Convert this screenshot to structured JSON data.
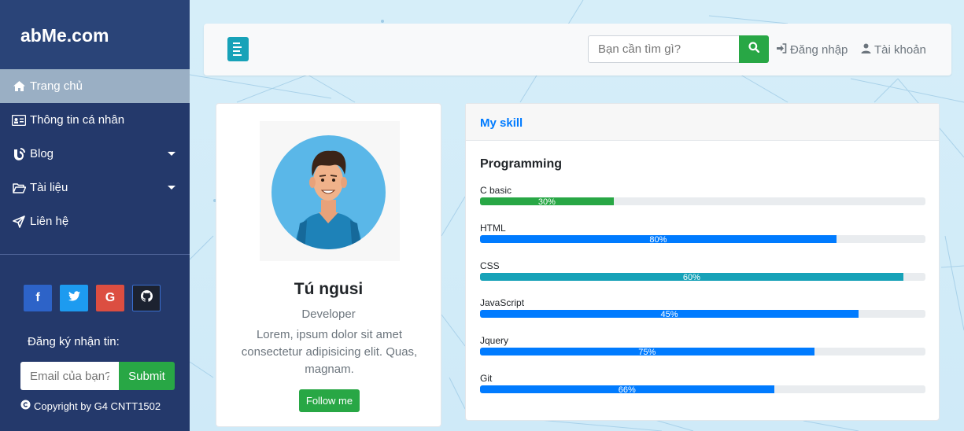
{
  "brand": "abMe.com",
  "sidebar": {
    "items": [
      {
        "label": "Trang chủ",
        "icon": "home-icon",
        "active": true
      },
      {
        "label": "Thông tin cá nhân",
        "icon": "id-card-icon"
      },
      {
        "label": "Blog",
        "icon": "blog-icon",
        "has_submenu": true
      },
      {
        "label": "Tài liệu",
        "icon": "folder-icon",
        "has_submenu": true
      },
      {
        "label": "Liên hệ",
        "icon": "paper-plane-icon"
      }
    ],
    "socials": [
      {
        "label": "f",
        "icon": "facebook-icon",
        "color": "#2d63c8"
      },
      {
        "label": "t",
        "icon": "twitter-icon",
        "color": "#1d9bf0"
      },
      {
        "label": "G",
        "icon": "google-icon",
        "color": "#dc4e41"
      },
      {
        "label": "gh",
        "icon": "github-icon",
        "color": "#1c2230"
      }
    ],
    "subscribe_label": "Đăng ký nhận tin:",
    "email_placeholder": "Email của bạn?",
    "submit_label": "Submit",
    "copyright": "Copyright by G4 CNTT1502"
  },
  "topbar": {
    "search_placeholder": "Bạn cần tìm gì?",
    "login_label": "Đăng nhập",
    "account_label": "Tài khoản"
  },
  "profile": {
    "name": "Tú ngusi",
    "role": "Developer",
    "bio": "Lorem, ipsum dolor sit amet consectetur adipisicing elit. Quas, magnam.",
    "follow_label": "Follow me"
  },
  "skills": {
    "title": "My skill",
    "subtitle": "Programming",
    "items": [
      {
        "name": "C basic",
        "percent": 30,
        "label": "30%",
        "color": "#28a745"
      },
      {
        "name": "HTML",
        "percent": 80,
        "label": "80%",
        "color": "#007bff"
      },
      {
        "name": "CSS",
        "percent": 95,
        "label": "60%",
        "color": "#17a2b8"
      },
      {
        "name": "JavaScript",
        "percent": 85,
        "label": "45%",
        "color": "#007bff"
      },
      {
        "name": "Jquery",
        "percent": 75,
        "label": "75%",
        "color": "#007bff"
      },
      {
        "name": "Git",
        "percent": 66,
        "label": "66%",
        "color": "#007bff"
      }
    ]
  },
  "colors": {
    "sidebar_bg": "#24396b",
    "active_item": "#9aafc4",
    "accent_green": "#28a745",
    "accent_blue": "#007bff",
    "accent_teal": "#17a2b8"
  }
}
